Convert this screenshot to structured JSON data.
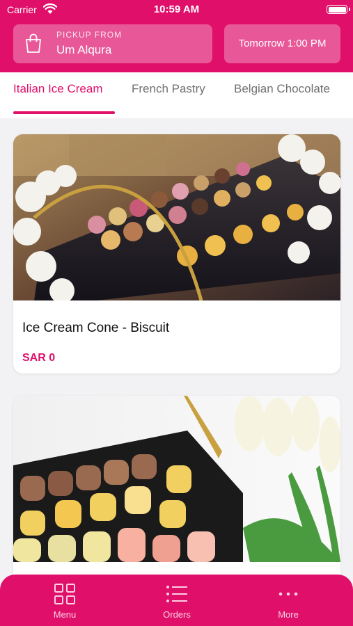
{
  "status_bar": {
    "carrier": "Carrier",
    "time": "10:59 AM"
  },
  "header": {
    "pickup_label": "PICKUP FROM",
    "pickup_location": "Um Alqura",
    "pickup_time": "Tomorrow 1:00 PM"
  },
  "category_tabs": [
    {
      "label": "Italian Ice Cream",
      "active": true
    },
    {
      "label": "French Pastry",
      "active": false
    },
    {
      "label": "Belgian Chocolate",
      "active": false
    }
  ],
  "products": [
    {
      "title": "Ice Cream Cone - Biscuit",
      "price": "SAR 0",
      "image": "ice-cream-cones-tray-photo"
    },
    {
      "title": "",
      "price": "",
      "image": "ice-cream-popsicles-box-photo"
    }
  ],
  "bottom_nav": [
    {
      "label": "Menu",
      "icon": "grid-icon"
    },
    {
      "label": "Orders",
      "icon": "list-icon"
    },
    {
      "label": "More",
      "icon": "more-dots-icon"
    }
  ],
  "colors": {
    "brand": "#df0f6a",
    "background": "#f2f2f4"
  }
}
